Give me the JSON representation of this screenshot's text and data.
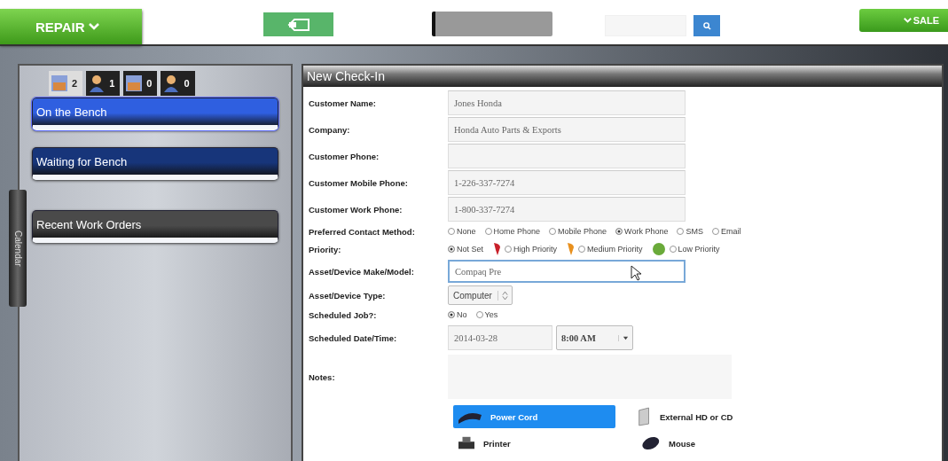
{
  "top_bar": {
    "menu_button": "REPAIR",
    "sale_button": "SALE"
  },
  "sidebar": {
    "counters": [
      {
        "count": "2",
        "selected": true
      },
      {
        "count": "1",
        "selected": false
      },
      {
        "count": "0",
        "selected": false
      },
      {
        "count": "0",
        "selected": false
      }
    ],
    "items": [
      {
        "label": "On the Bench",
        "selected": true,
        "color": "#2f5fe0"
      },
      {
        "label": "Waiting for Bench",
        "selected": false,
        "color": "#17357a"
      },
      {
        "label": "Recent Work Orders",
        "selected": false,
        "color": "#4a4a4a"
      }
    ],
    "side_tab": "Calendar"
  },
  "form": {
    "title": "New Check-In",
    "rows": [
      {
        "kind": "text",
        "label": "Customer Name:",
        "value": "Jones Honda",
        "focused": false
      },
      {
        "kind": "text",
        "label": "Company:",
        "value": "Honda Auto Parts & Exports",
        "focused": false
      },
      {
        "kind": "text",
        "label": "Customer Phone:",
        "value": "",
        "focused": false
      },
      {
        "kind": "text",
        "label": "Customer Mobile Phone:",
        "value": "1-226-337-7274",
        "focused": false
      },
      {
        "kind": "text",
        "label": "Customer Work Phone:",
        "value": "1-800-337-7274",
        "focused": false
      },
      {
        "kind": "radio",
        "label": "Preferred Contact Method:",
        "options": [
          {
            "label": "None",
            "selected": false
          },
          {
            "label": "Home Phone",
            "selected": false
          },
          {
            "label": "Mobile Phone",
            "selected": false
          },
          {
            "label": "Work Phone",
            "selected": true
          },
          {
            "label": "SMS",
            "selected": false
          },
          {
            "label": "Email",
            "selected": false
          }
        ]
      },
      {
        "kind": "radio",
        "label": "Priority:",
        "options": [
          {
            "label": "Not Set",
            "selected": true
          },
          {
            "label": "High Priority",
            "selected": false,
            "color": "#c8202a"
          },
          {
            "label": "Medium Priority",
            "selected": false,
            "color": "#e8901e"
          },
          {
            "label": "Low Priority",
            "selected": false,
            "color": "#6aaa3a"
          }
        ]
      },
      {
        "kind": "text",
        "label": "Asset/Device Make/Model:",
        "value": "Compaq Pre",
        "focused": true
      },
      {
        "kind": "select",
        "label": "Asset/Device Type:",
        "value": "Computer"
      },
      {
        "kind": "radio",
        "label": "Scheduled Job?:",
        "options": [
          {
            "label": "No",
            "selected": true
          },
          {
            "label": "Yes",
            "selected": false
          }
        ]
      },
      {
        "kind": "datetime",
        "label": "Scheduled Date/Time:",
        "date": "2014-03-28",
        "time": "8:00 AM"
      },
      {
        "kind": "textarea",
        "label": "Notes:",
        "value": ""
      }
    ],
    "accessories": [
      {
        "label": "Power Cord",
        "selected": true
      },
      {
        "label": "External HD or CD",
        "selected": false
      },
      {
        "label": "Printer",
        "selected": false
      },
      {
        "label": "Mouse",
        "selected": false
      }
    ]
  }
}
